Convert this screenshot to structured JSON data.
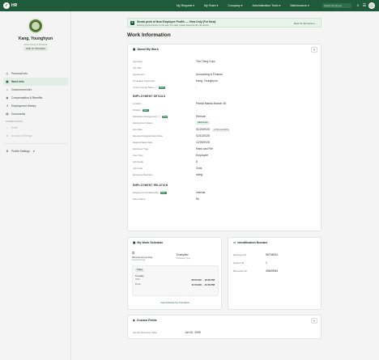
{
  "brand": {
    "name": "HR"
  },
  "nav": {
    "items": [
      "My Request",
      "My Team",
      "Company",
      "Administration Tools",
      "Maintenance"
    ],
    "search_placeholder": "Search Employee"
  },
  "profile": {
    "name": "Kang, Younghyun",
    "department": "Accounting & Finance",
    "employee_id": "EMP ID: 98734834"
  },
  "sidebar": {
    "items": [
      {
        "label": "Personal Info",
        "icon": "user-icon"
      },
      {
        "label": "Work Info",
        "icon": "briefcase-icon",
        "active": true
      },
      {
        "label": "Government Info",
        "icon": "bank-icon"
      },
      {
        "label": "Compensation & Benefits",
        "icon": "coins-icon"
      },
      {
        "label": "Employment History",
        "icon": "history-icon"
      },
      {
        "label": "Documents",
        "icon": "document-icon"
      }
    ],
    "coming_soon_label": "COMING SOON",
    "coming_soon": [
      {
        "label": "Skills",
        "icon": "star-icon"
      },
      {
        "label": "Account Settings",
        "icon": "gear-icon"
      }
    ],
    "profile_settings": "Profile Settings"
  },
  "banner": {
    "title": "Sneak peek of New Employee Profile — View Only (For Now)",
    "subtitle": "Exciting improvements on the way! For edits, please head into the old version.",
    "back_link": "Back To Old Version"
  },
  "page_title": "Work Information",
  "about": {
    "title": "About My Work",
    "fields": [
      {
        "label": "Company",
        "value": "The Thing Corp"
      },
      {
        "label": "Job Title",
        "value": ""
      },
      {
        "label": "Department",
        "value": "Accounting & Finance"
      },
      {
        "label": "Immediate Supervisor",
        "value": "Kang, Younghyun"
      },
      {
        "label": "Custom Group Name",
        "value": "-",
        "tag": "New"
      }
    ],
    "employment_details_title": "EMPLOYMENT DETAILS",
    "employment": [
      {
        "label": "Location",
        "value": "Panda Manila Branch 26"
      },
      {
        "label": "Division",
        "value": "-",
        "tag": "New"
      },
      {
        "label": "Workplace Arrangement",
        "value": "Remote",
        "tag": "New"
      },
      {
        "label": "Employment Status",
        "value": "REGULAR",
        "pill": true
      },
      {
        "label": "Hire Date",
        "value": "01/20/2025",
        "extra": "2 YRS 4 & DAYS"
      },
      {
        "label": "Expected Regularization Date",
        "value": "02/10/2025"
      },
      {
        "label": "Regularization Date",
        "value": "12/30/2025"
      },
      {
        "label": "Employee Type",
        "value": "Rank and File"
      },
      {
        "label": "User Type",
        "value": "Employee"
      },
      {
        "label": "Job Grade",
        "value": "8"
      },
      {
        "label": "Job Code",
        "value": "Grok"
      },
      {
        "label": "Employee Remarks",
        "value": "string"
      }
    ],
    "relation_title": "EMPLOYMENT RELATION",
    "relation": [
      {
        "label": "Employment Relationship",
        "value": "Internal",
        "tag": "New"
      },
      {
        "label": "Client Name",
        "value": "NL"
      }
    ]
  },
  "schedule": {
    "title": "My Work Schedule",
    "hours_label": "Work Hours per Day",
    "hours_sub": "Including break",
    "type_value": "Exempted",
    "type_label": "Schedule Type",
    "today_badge": "Today",
    "day": "Tuesday",
    "shift_label": "Shift",
    "shift_value": "06:00 AM → 04:00 PM",
    "break_label": "Break",
    "break_value": "11:00 AM → 12:00 PM",
    "link": "View Schedule For This Week"
  },
  "identification": {
    "title": "Identification Number",
    "fields": [
      {
        "label": "Employee ID",
        "value": "98734834"
      },
      {
        "label": "System ID",
        "value": "1"
      },
      {
        "label": "Biometrics ID",
        "value": "45609984"
      }
    ]
  },
  "custom_fields": {
    "title": "Custom Fields",
    "fields": [
      {
        "label": "Service Reference Date",
        "value": "Jun 20, 2005"
      }
    ]
  }
}
